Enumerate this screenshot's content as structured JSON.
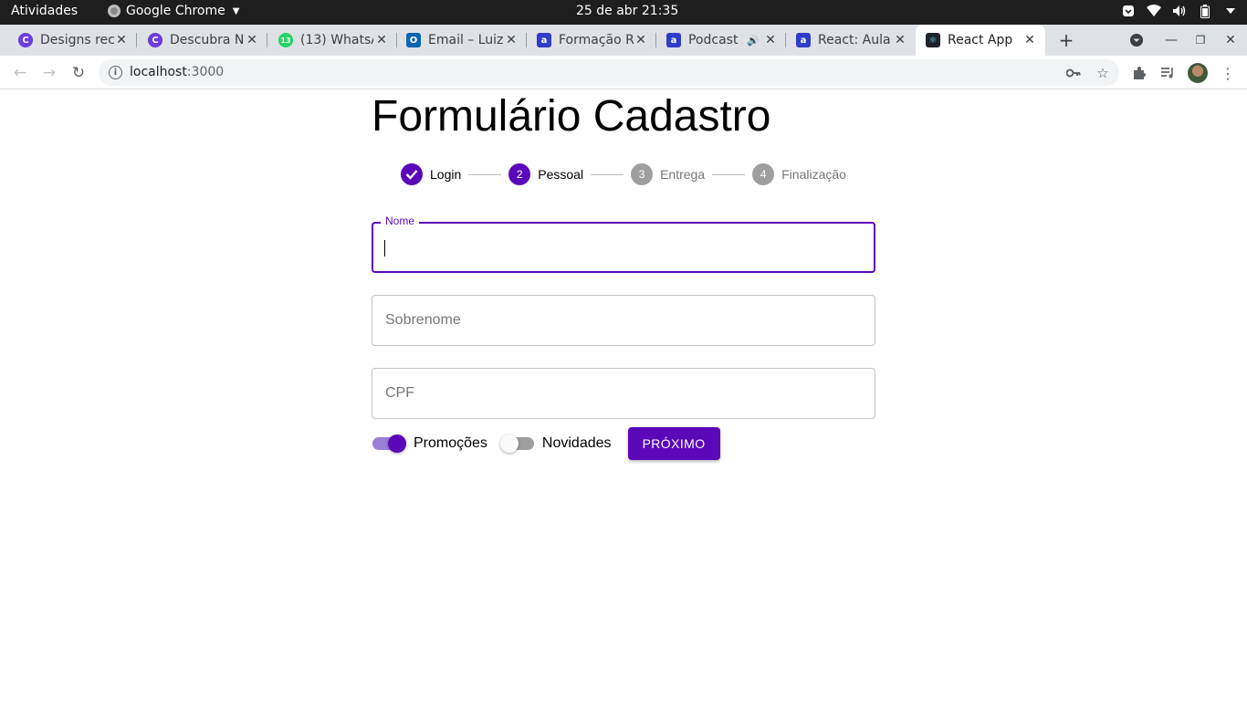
{
  "os_bar": {
    "activities": "Atividades",
    "app_name": "Google Chrome",
    "clock": "25 de abr  21:35"
  },
  "tabs": [
    {
      "label": "Designs rec",
      "favicon": "canva-icon"
    },
    {
      "label": "Descubra N",
      "favicon": "canva-icon"
    },
    {
      "label": "(13) WhatsA",
      "favicon": "whatsapp-icon",
      "badge": "13"
    },
    {
      "label": "Email – Luiz",
      "favicon": "outlook-icon"
    },
    {
      "label": "Formação R",
      "favicon": "alura-icon"
    },
    {
      "label": "Podcast",
      "favicon": "alura-icon",
      "audio": true
    },
    {
      "label": "React: Aula",
      "favicon": "alura-icon"
    },
    {
      "label": "React App",
      "favicon": "react-icon",
      "active": true
    }
  ],
  "address_bar": {
    "host": "localhost",
    "port": ":3000"
  },
  "form": {
    "title": "Formulário Cadastro",
    "steps": [
      {
        "label": "Login",
        "marker": "✓",
        "state": "done"
      },
      {
        "label": "Pessoal",
        "marker": "2",
        "state": "active"
      },
      {
        "label": "Entrega",
        "marker": "3",
        "state": "todo"
      },
      {
        "label": "Finalização",
        "marker": "4",
        "state": "todo"
      }
    ],
    "fields": {
      "nome": {
        "label": "Nome",
        "value": ""
      },
      "sobrenome": {
        "placeholder": "Sobrenome",
        "value": ""
      },
      "cpf": {
        "placeholder": "CPF",
        "value": ""
      }
    },
    "switches": {
      "promocoes": {
        "label": "Promoções",
        "checked": true
      },
      "novidades": {
        "label": "Novidades",
        "checked": false
      }
    },
    "next_button": "PRÓXIMO"
  },
  "colors": {
    "primary": "#5b08b8",
    "chrome_tabstrip": "#dee1e6",
    "os_bar": "#1e1e1e"
  }
}
